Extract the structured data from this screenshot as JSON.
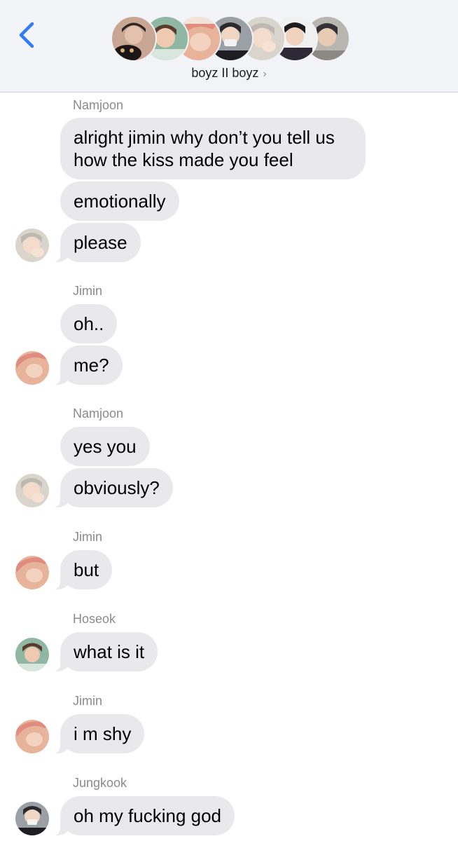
{
  "header": {
    "group_name": "boyz II boyz",
    "back_icon": "chevron-left-icon",
    "accent_color": "#2f7cf6"
  },
  "avatars": [
    {
      "member": "1",
      "bg": "#c9a693",
      "fg": "#3b2d28"
    },
    {
      "member": "2",
      "bg": "#8fb7a4",
      "fg": "#5a3b2b"
    },
    {
      "member": "3",
      "bg": "#e7b39a",
      "fg": "#c8756d"
    },
    {
      "member": "4",
      "bg": "#9aa0a6",
      "fg": "#2b2a2e"
    },
    {
      "member": "5",
      "bg": "#d9d4cc",
      "fg": "#b9b3aa"
    },
    {
      "member": "6",
      "bg": "#5b5e6c",
      "fg": "#1f1c1e"
    },
    {
      "member": "7",
      "bg": "#b9b6b2",
      "fg": "#343034"
    }
  ],
  "messages": [
    {
      "sender": "Namjoon",
      "bubbles": [
        "alright jimin why don’t you tell us how the kiss made you feel",
        "emotionally",
        "please"
      ]
    },
    {
      "sender": "Jimin",
      "bubbles": [
        "oh..",
        "me?"
      ]
    },
    {
      "sender": "Namjoon",
      "bubbles": [
        "yes you",
        "obviously?"
      ]
    },
    {
      "sender": "Jimin",
      "bubbles": [
        "but"
      ]
    },
    {
      "sender": "Hoseok",
      "bubbles": [
        "what is it"
      ]
    },
    {
      "sender": "Jimin",
      "bubbles": [
        "i m shy"
      ]
    },
    {
      "sender": "Jungkook",
      "bubbles": [
        "oh my fucking god"
      ]
    }
  ],
  "colors": {
    "bubble_bg": "#e9e9eb",
    "sender_text": "#8a8a8e",
    "header_bg": "#f2f3f7"
  }
}
